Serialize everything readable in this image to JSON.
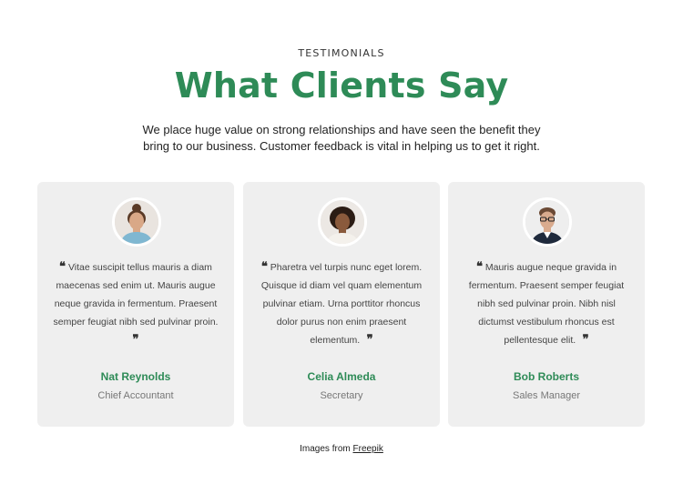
{
  "header": {
    "eyebrow": "TESTIMONIALS",
    "title": "What Clients Say",
    "intro": "We place huge value on strong relationships and have seen the benefit they bring to our business. Customer feedback is vital in helping us to get it right."
  },
  "testimonials": [
    {
      "quote": "Vitae suscipit tellus mauris a diam maecenas sed enim ut. Mauris augue neque gravida in fermentum. Praesent semper feugiat nibh sed pulvinar proin.",
      "name": "Nat Reynolds",
      "role": "Chief Accountant",
      "avatar": "woman-avatar"
    },
    {
      "quote": "Pharetra vel turpis nunc eget lorem. Quisque id diam vel quam elementum pulvinar etiam. Urna porttitor rhoncus dolor purus non enim praesent elementum.",
      "name": "Celia Almeda",
      "role": "Secretary",
      "avatar": "woman-curly-avatar"
    },
    {
      "quote": "Mauris augue neque gravida in fermentum. Praesent semper feugiat nibh sed pulvinar proin. Nibh nisl dictumst vestibulum rhoncus est pellentesque elit.",
      "name": "Bob Roberts",
      "role": "Sales Manager",
      "avatar": "man-glasses-avatar"
    }
  ],
  "footer": {
    "credit_prefix": "Images from",
    "credit_link": "Freepik"
  },
  "colors": {
    "accent": "#2e8b57",
    "card_bg": "#efefef",
    "text": "#333333"
  }
}
